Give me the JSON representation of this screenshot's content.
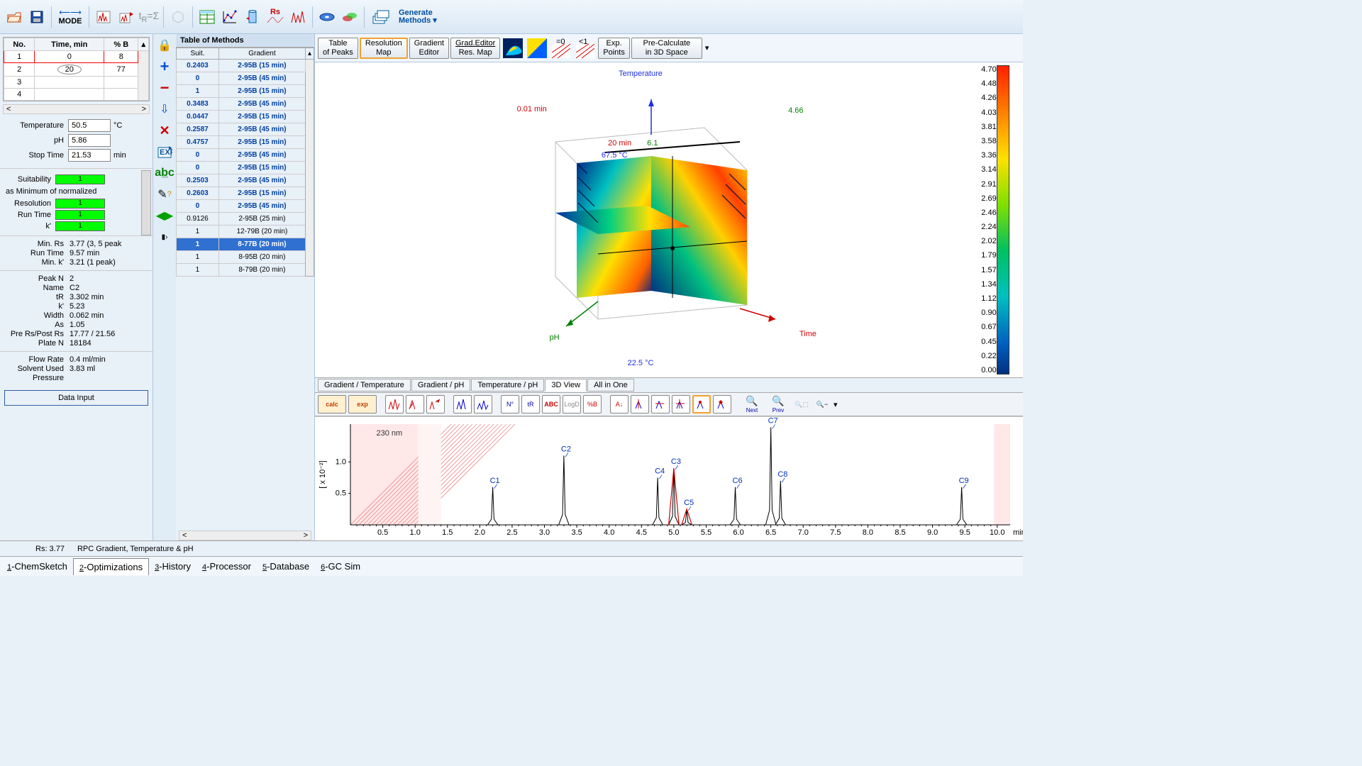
{
  "top_toolbar": {
    "generate_methods_1": "Generate",
    "generate_methods_2": "Methods"
  },
  "gradient_table": {
    "headers": [
      "No.",
      "Time, min",
      "% B"
    ],
    "rows": [
      {
        "no": "1",
        "time": "0",
        "b": "8"
      },
      {
        "no": "2",
        "time": "20",
        "b": "77"
      },
      {
        "no": "3",
        "time": "",
        "b": ""
      },
      {
        "no": "4",
        "time": "",
        "b": ""
      }
    ]
  },
  "params": {
    "temp_lbl": "Temperature",
    "temp_val": "50.5",
    "temp_unit": "°C",
    "ph_lbl": "pH",
    "ph_val": "5.86",
    "stop_lbl": "Stop Time",
    "stop_val": "21.53",
    "stop_unit": "min"
  },
  "suit": {
    "suitability_lbl": "Suitability",
    "suitability_val": "1",
    "norm_txt": "as Minimum of normalized",
    "res_lbl": "Resolution",
    "res_val": "1",
    "rt_lbl": "Run Time",
    "rt_val": "1",
    "k_lbl": "k'",
    "k_val": "1"
  },
  "stats1": {
    "min_rs_lbl": "Min. Rs",
    "min_rs_val": "3.77 (3, 5 peak",
    "run_time_lbl": "Run Time",
    "run_time_val": "9.57 min",
    "min_k_lbl": "Min. k'",
    "min_k_val": "3.21 (1 peak)"
  },
  "stats2": {
    "peakn_lbl": "Peak N",
    "peakn_val": "2",
    "name_lbl": "Name",
    "name_val": "C2",
    "tr_lbl": "tR",
    "tr_val": "3.302 min",
    "k_lbl": "k'",
    "k_val": "5.23",
    "width_lbl": "Width",
    "width_val": "0.062 min",
    "as_lbl": "As",
    "as_val": "1.05",
    "prers_lbl": "Pre Rs/Post Rs",
    "prers_val": "17.77 / 21.56",
    "platen_lbl": "Plate N",
    "platen_val": "18184"
  },
  "stats3": {
    "flow_lbl": "Flow Rate",
    "flow_val": "0.4 ml/min",
    "solv_lbl": "Solvent Used",
    "solv_val": "3.83 ml",
    "press_lbl": "Pressure",
    "press_val": ""
  },
  "data_input_btn": "Data Input",
  "methods": {
    "title": "Table of Methods",
    "hdr_suit": "Suit.",
    "hdr_grad": "Gradient",
    "rows": [
      {
        "s": "0.2403",
        "g": "2-95B (15 min)",
        "k": "b"
      },
      {
        "s": "0",
        "g": "2-95B (45 min)",
        "k": "b"
      },
      {
        "s": "1",
        "g": "2-95B (15 min)",
        "k": "b"
      },
      {
        "s": "0.3483",
        "g": "2-95B (45 min)",
        "k": "b"
      },
      {
        "s": "0.0447",
        "g": "2-95B (15 min)",
        "k": "b"
      },
      {
        "s": "0.2587",
        "g": "2-95B (45 min)",
        "k": "b"
      },
      {
        "s": "0.4757",
        "g": "2-95B (15 min)",
        "k": "b"
      },
      {
        "s": "0",
        "g": "2-95B (45 min)",
        "k": "b"
      },
      {
        "s": "0",
        "g": "2-95B (15 min)",
        "k": "b"
      },
      {
        "s": "0.2503",
        "g": "2-95B (45 min)",
        "k": "b"
      },
      {
        "s": "0.2603",
        "g": "2-95B (15 min)",
        "k": "b"
      },
      {
        "s": "0",
        "g": "2-95B (45 min)",
        "k": "b"
      },
      {
        "s": "0.9126",
        "g": "2-95B (25 min)",
        "k": "p"
      },
      {
        "s": "1",
        "g": "12-79B (20 min)",
        "k": "p"
      },
      {
        "s": "1",
        "g": "8-77B (20 min)",
        "k": "sel"
      },
      {
        "s": "1",
        "g": "8-95B (20 min)",
        "k": "p"
      },
      {
        "s": "1",
        "g": "8-79B (20 min)",
        "k": "p"
      }
    ]
  },
  "right_tb": {
    "table_peaks_1": "Table",
    "table_peaks_2": "of Peaks",
    "res_map_1": "Resolution",
    "res_map_2": "Map",
    "grad_ed_1": "Gradient",
    "grad_ed_2": "Editor",
    "gred_1": "Grad.Editor",
    "gred_2": "Res. Map",
    "exp_pts_1": "Exp.",
    "exp_pts_2": "Points",
    "precalc_1": "Pre-Calculate",
    "precalc_2": "in 3D Space"
  },
  "cube": {
    "temp_lbl": "Temperature",
    "ph_lbl": "pH",
    "time_lbl": "Time",
    "t_lo": "0.01 min",
    "t_hi": "4.66",
    "temp_hi": "67.5 °C",
    "temp_lo": "22.5 °C",
    "ann1": "20 min",
    "ann2": "6.1"
  },
  "legend_ticks": [
    "4.70",
    "4.48",
    "4.26",
    "4.03",
    "3.81",
    "3.58",
    "3.36",
    "3.14",
    "2.91",
    "2.69",
    "2.46",
    "2.24",
    "2.02",
    "1.79",
    "1.57",
    "1.34",
    "1.12",
    "0.90",
    "0.67",
    "0.45",
    "0.22",
    "0.00"
  ],
  "view_tabs": [
    "Gradient / Temperature",
    "Gradient / pH",
    "Temperature / pH",
    "3D View",
    "All in One"
  ],
  "view_tab_active": 3,
  "chrom": {
    "wavelength": "230 nm",
    "yaxis": "[ x 10⁻²]",
    "yticks": [
      "0.5",
      "1.0"
    ],
    "xunit": "min",
    "nav_next": "Next",
    "nav_prev": "Prev",
    "calc": "calc",
    "exp": "exp",
    "no_lbl": "N°",
    "tr_lbl": "tR",
    "abc_lbl": "ABC",
    "logd_lbl": "LogD",
    "pb_lbl": "%B"
  },
  "chart_data": {
    "type": "line",
    "title": "230 nm",
    "xlabel": "min",
    "ylabel": "[ x 10⁻²]",
    "xlim": [
      0,
      10.2
    ],
    "ylim": [
      0,
      1.6
    ],
    "xticks": [
      0.5,
      1.0,
      1.5,
      2.0,
      2.5,
      3.0,
      3.5,
      4.0,
      4.5,
      5.0,
      5.5,
      6.0,
      6.5,
      7.0,
      7.5,
      8.0,
      8.5,
      9.0,
      9.5,
      10.0
    ],
    "peaks": [
      {
        "name": "C1",
        "tR": 2.2,
        "h": 0.6
      },
      {
        "name": "C2",
        "tR": 3.3,
        "h": 1.1
      },
      {
        "name": "C4",
        "tR": 4.75,
        "h": 0.75
      },
      {
        "name": "C3",
        "tR": 5.0,
        "h": 0.9,
        "color": "red"
      },
      {
        "name": "C5",
        "tR": 5.2,
        "h": 0.25,
        "color": "red"
      },
      {
        "name": "C6",
        "tR": 5.95,
        "h": 0.6
      },
      {
        "name": "C7",
        "tR": 6.5,
        "h": 1.55
      },
      {
        "name": "C8",
        "tR": 6.65,
        "h": 0.7
      },
      {
        "name": "C9",
        "tR": 9.45,
        "h": 0.6
      }
    ]
  },
  "footer": {
    "rs": "Rs: 3.77",
    "mode": "RPC Gradient, Temperature & pH"
  },
  "footer_tabs": [
    "1-ChemSketch",
    "2-Optimizations",
    "3-History",
    "4-Processor",
    "5-Database",
    "6-GC Sim"
  ],
  "footer_tab_active": 1
}
